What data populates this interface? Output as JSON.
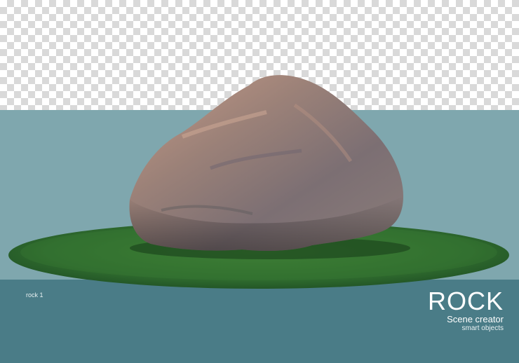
{
  "background": {
    "transparent_checker_light": "#ffffff",
    "transparent_checker_dark": "#d9d9d9",
    "upper_band_color": "#7fa7ae",
    "lower_band_color": "#4a7c87"
  },
  "scene": {
    "object": "rock",
    "grass_color": "#2f6b2e",
    "rock_color": "#8e7a72"
  },
  "text": {
    "caption": "rock 1",
    "title": "ROCK",
    "subtitle": "Scene creator",
    "subsubtitle": "smart objects"
  }
}
